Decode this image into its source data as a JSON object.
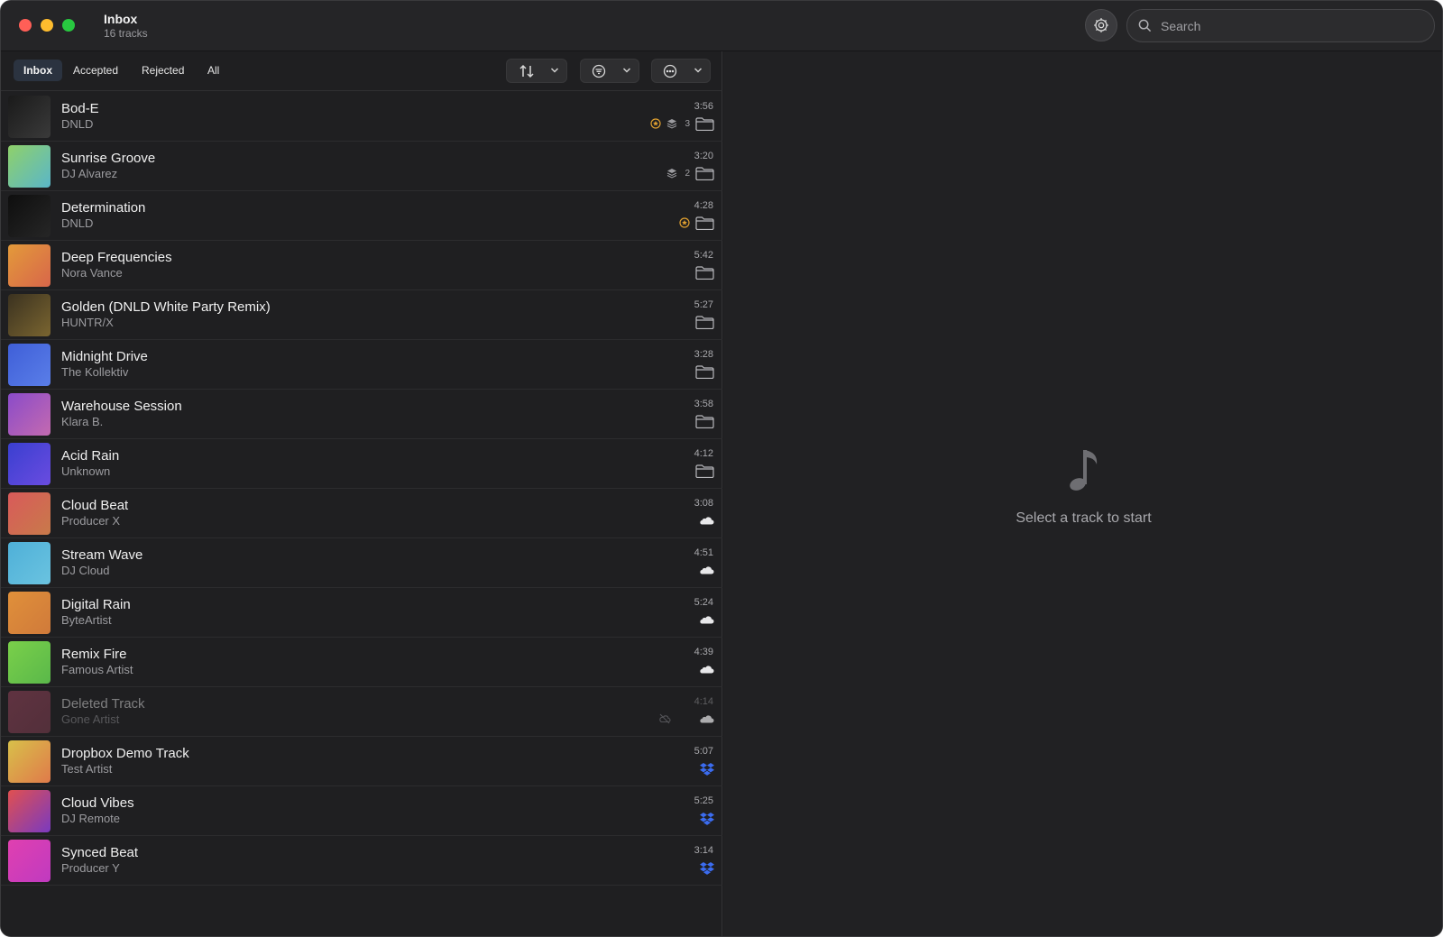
{
  "window": {
    "title": "Inbox",
    "subtitle": "16 tracks"
  },
  "search": {
    "placeholder": "Search"
  },
  "tabs": [
    {
      "label": "Inbox",
      "active": true
    },
    {
      "label": "Accepted",
      "active": false
    },
    {
      "label": "Rejected",
      "active": false
    },
    {
      "label": "All",
      "active": false
    }
  ],
  "toolbar_menus": [
    "sort-menu",
    "filter-menu",
    "more-menu"
  ],
  "tracks": [
    {
      "title": "Bod-E",
      "artist": "DNLD",
      "duration": "3:56",
      "icons": [
        "star-badge-icon",
        "stack-icon",
        "folder-icon"
      ],
      "count": "3",
      "art": [
        "#1a1a1a",
        "#3a3a3a"
      ],
      "dim": false
    },
    {
      "title": "Sunrise Groove",
      "artist": "DJ Alvarez",
      "duration": "3:20",
      "icons": [
        "stack-icon",
        "folder-icon"
      ],
      "count": "2",
      "art": [
        "#8fd16a",
        "#5ab6c9"
      ],
      "dim": false
    },
    {
      "title": "Determination",
      "artist": "DNLD",
      "duration": "4:28",
      "icons": [
        "star-badge-icon",
        "folder-icon"
      ],
      "count": "",
      "art": [
        "#0e0e0e",
        "#262626"
      ],
      "dim": false
    },
    {
      "title": "Deep Frequencies",
      "artist": "Nora Vance",
      "duration": "5:42",
      "icons": [
        "folder-icon"
      ],
      "count": "",
      "art": [
        "#e39a3a",
        "#d8664a"
      ],
      "dim": false
    },
    {
      "title": "Golden (DNLD White Party Remix)",
      "artist": "HUNTR/X",
      "duration": "5:27",
      "icons": [
        "folder-icon"
      ],
      "count": "",
      "art": [
        "#3b3220",
        "#7a6530"
      ],
      "dim": false
    },
    {
      "title": "Midnight Drive",
      "artist": "The Kollektiv",
      "duration": "3:28",
      "icons": [
        "folder-icon"
      ],
      "count": "",
      "art": [
        "#3f5fd8",
        "#5a7ee8"
      ],
      "dim": false
    },
    {
      "title": "Warehouse Session",
      "artist": "Klara B.",
      "duration": "3:58",
      "icons": [
        "folder-icon"
      ],
      "count": "",
      "art": [
        "#8a4bc9",
        "#c46ab0"
      ],
      "dim": false
    },
    {
      "title": "Acid Rain",
      "artist": "Unknown",
      "duration": "4:12",
      "icons": [
        "folder-icon"
      ],
      "count": "",
      "art": [
        "#3a3fd0",
        "#6a4ce0"
      ],
      "dim": false
    },
    {
      "title": "Cloud Beat",
      "artist": "Producer X",
      "duration": "3:08",
      "icons": [
        "cloud-icon"
      ],
      "count": "",
      "art": [
        "#d95a5a",
        "#c87a4a"
      ],
      "dim": false
    },
    {
      "title": "Stream Wave",
      "artist": "DJ Cloud",
      "duration": "4:51",
      "icons": [
        "cloud-icon"
      ],
      "count": "",
      "art": [
        "#4fb0d8",
        "#6ac3e0"
      ],
      "dim": false
    },
    {
      "title": "Digital Rain",
      "artist": "ByteArtist",
      "duration": "5:24",
      "icons": [
        "cloud-icon"
      ],
      "count": "",
      "art": [
        "#e0903a",
        "#d07a3a"
      ],
      "dim": false
    },
    {
      "title": "Remix Fire",
      "artist": "Famous Artist",
      "duration": "4:39",
      "icons": [
        "cloud-icon"
      ],
      "count": "",
      "art": [
        "#7ad04a",
        "#5ab84a"
      ],
      "dim": false
    },
    {
      "title": "Deleted Track",
      "artist": "Gone Artist",
      "duration": "4:14",
      "icons": [
        "cloud-off-icon",
        "cloud-icon"
      ],
      "count": "",
      "art": [
        "#c05070",
        "#a04860"
      ],
      "dim": true
    },
    {
      "title": "Dropbox Demo Track",
      "artist": "Test Artist",
      "duration": "5:07",
      "icons": [
        "dropbox-icon"
      ],
      "count": "",
      "art": [
        "#d8c04a",
        "#e07a4a"
      ],
      "dim": false
    },
    {
      "title": "Cloud Vibes",
      "artist": "DJ Remote",
      "duration": "5:25",
      "icons": [
        "dropbox-icon"
      ],
      "count": "",
      "art": [
        "#e05050",
        "#7a3ac0"
      ],
      "dim": false
    },
    {
      "title": "Synced Beat",
      "artist": "Producer Y",
      "duration": "3:14",
      "icons": [
        "dropbox-icon"
      ],
      "count": "",
      "art": [
        "#e040b0",
        "#c03ac0"
      ],
      "dim": false
    }
  ],
  "empty_state": {
    "icon": "music-note-icon",
    "text": "Select a track to start"
  },
  "colors": {
    "background": "#1f1f21",
    "accent_tab": "#2b3340",
    "star": "#e0a030",
    "dropbox": "#3b6cf0"
  }
}
